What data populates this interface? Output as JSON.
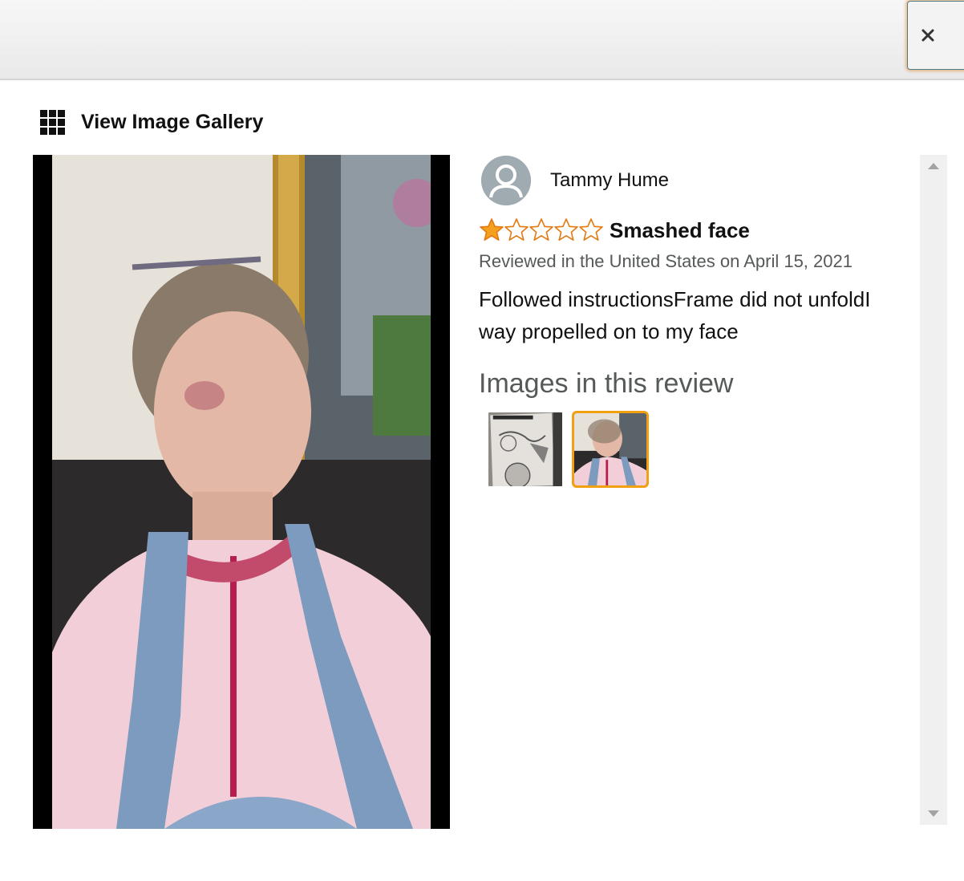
{
  "header": {
    "close_icon": "close-icon"
  },
  "gallery_link": {
    "icon": "grid-icon",
    "label": "View Image Gallery"
  },
  "review": {
    "reviewer_name": "Tammy Hume",
    "rating": 1,
    "rating_max": 5,
    "title": "Smashed face",
    "date": "Reviewed in the United States on April 15, 2021",
    "body": "Followed instructionsFrame did not unfoldI way propelled on to my face",
    "images_heading": "Images in this review",
    "thumbnail_count": 2,
    "selected_thumbnail": 2
  },
  "colors": {
    "star_filled": "#f3a01f",
    "star_outline": "#e47911",
    "selected_border": "#f0a010",
    "secondary_text": "#565959"
  }
}
